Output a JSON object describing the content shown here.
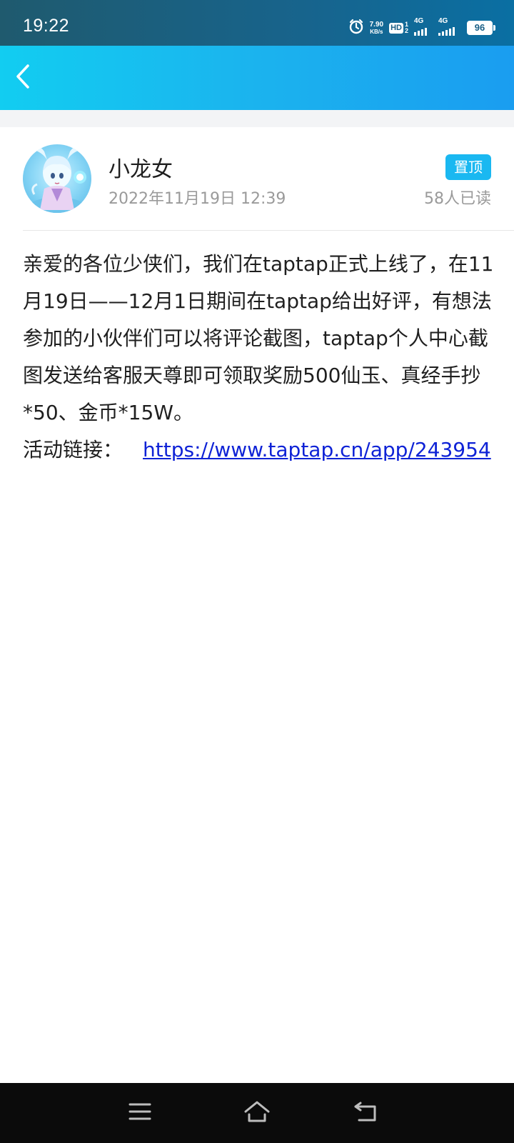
{
  "status_bar": {
    "time": "19:22",
    "net_speed": "7.90",
    "net_speed_unit": "KB/s",
    "hd": "HD",
    "hd_sim_top": "1",
    "hd_sim_bottom": "2",
    "network_1": "4G",
    "network_2": "4G",
    "battery": "96",
    "icons": [
      "alarm-icon",
      "signal-icon",
      "battery-icon"
    ]
  },
  "header": {
    "back_icon": "chevron-left-icon",
    "colors": {
      "start": "#12cdf1",
      "end": "#1a9df0"
    }
  },
  "post": {
    "author": "小龙女",
    "date": "2022年11月19日 12:39",
    "pin_label": "置顶",
    "read_count": "58人已读",
    "body_text": "亲爱的各位少侠们，我们在taptap正式上线了，在11月19日——12月1日期间在taptap给出好评，有想法参加的小伙伴们可以将评论截图，taptap个人中心截图发送给客服天尊即可领取奖励500仙玉、真经手抄*50、金币*15W。",
    "link_label": "活动链接：",
    "link_url": "https://www.taptap.cn/app/243954"
  },
  "nav_bar": {
    "buttons": [
      "menu-icon",
      "home-icon",
      "back-icon"
    ]
  }
}
